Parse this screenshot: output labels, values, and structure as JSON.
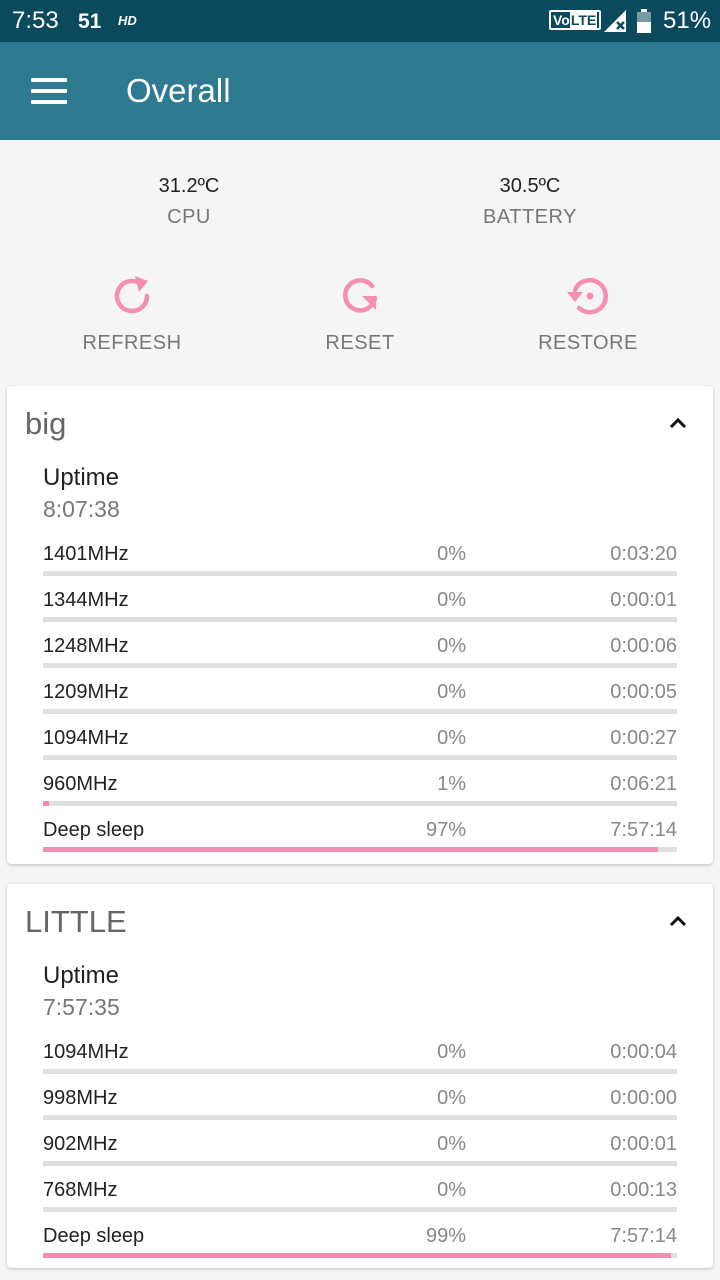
{
  "status_bar": {
    "time": "7:53",
    "notification": "51",
    "hd": "HD",
    "volte_vo": "Vo",
    "volte_lte": "LTE",
    "battery": "51%"
  },
  "app_bar": {
    "title": "Overall",
    "menu_icon": "hamburger-menu-icon"
  },
  "temperatures": {
    "cpu": {
      "value": "31.2ºC",
      "label": "CPU"
    },
    "battery": {
      "value": "30.5ºC",
      "label": "BATTERY"
    }
  },
  "actions": {
    "refresh": {
      "label": "REFRESH",
      "icon": "refresh-icon"
    },
    "reset": {
      "label": "RESET",
      "icon": "reset-icon"
    },
    "restore": {
      "label": "RESTORE",
      "icon": "restore-icon"
    }
  },
  "accent_color": "#f48fb1",
  "clusters": [
    {
      "name": "big",
      "uptime_label": "Uptime",
      "uptime": "8:07:38",
      "states": [
        {
          "freq": "1401MHz",
          "pct": "0%",
          "time": "0:03:20",
          "fraction": 0.0
        },
        {
          "freq": "1344MHz",
          "pct": "0%",
          "time": "0:00:01",
          "fraction": 0.0
        },
        {
          "freq": "1248MHz",
          "pct": "0%",
          "time": "0:00:06",
          "fraction": 0.0
        },
        {
          "freq": "1209MHz",
          "pct": "0%",
          "time": "0:00:05",
          "fraction": 0.0
        },
        {
          "freq": "1094MHz",
          "pct": "0%",
          "time": "0:00:27",
          "fraction": 0.0
        },
        {
          "freq": "960MHz",
          "pct": "1%",
          "time": "0:06:21",
          "fraction": 0.01
        },
        {
          "freq": "Deep sleep",
          "pct": "97%",
          "time": "7:57:14",
          "fraction": 0.97
        }
      ]
    },
    {
      "name": "LITTLE",
      "uptime_label": "Uptime",
      "uptime": "7:57:35",
      "states": [
        {
          "freq": "1094MHz",
          "pct": "0%",
          "time": "0:00:04",
          "fraction": 0.0
        },
        {
          "freq": "998MHz",
          "pct": "0%",
          "time": "0:00:00",
          "fraction": 0.0
        },
        {
          "freq": "902MHz",
          "pct": "0%",
          "time": "0:00:01",
          "fraction": 0.0
        },
        {
          "freq": "768MHz",
          "pct": "0%",
          "time": "0:00:13",
          "fraction": 0.0
        },
        {
          "freq": "Deep sleep",
          "pct": "99%",
          "time": "7:57:14",
          "fraction": 0.99
        }
      ]
    }
  ]
}
